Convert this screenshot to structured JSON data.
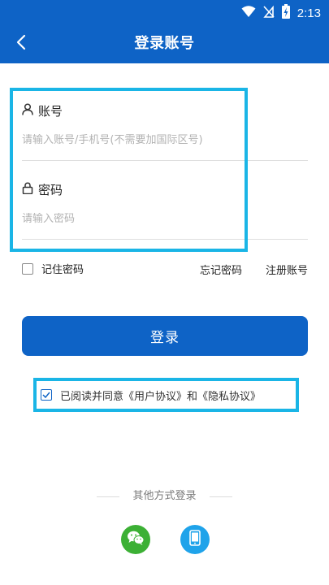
{
  "status_bar": {
    "time": "2:13",
    "icons": [
      "wifi-icon",
      "no-signal-icon",
      "battery-charging-icon"
    ]
  },
  "header": {
    "title": "登录账号",
    "back_icon": "back-arrow-icon"
  },
  "form": {
    "account": {
      "label": "账号",
      "icon": "user-icon",
      "placeholder": "请输入账号/手机号(不需要加国际区号)",
      "value": ""
    },
    "password": {
      "label": "密码",
      "icon": "lock-icon",
      "placeholder": "请输入密码",
      "value": ""
    }
  },
  "options": {
    "remember_password": "记住密码",
    "remember_checked": false,
    "forgot_password": "忘记密码",
    "register": "注册账号"
  },
  "login_button": "登录",
  "agreement": {
    "checked": true,
    "text": "已阅读并同意《用户协议》和《隐私协议》"
  },
  "other_login": {
    "title": "其他方式登录",
    "methods": [
      {
        "icon": "wechat-icon",
        "color": "#3cb035"
      },
      {
        "icon": "phone-icon",
        "color": "#1fa3ea"
      }
    ]
  },
  "colors": {
    "primary": "#0e63c6",
    "highlight": "#1ab5e6"
  }
}
